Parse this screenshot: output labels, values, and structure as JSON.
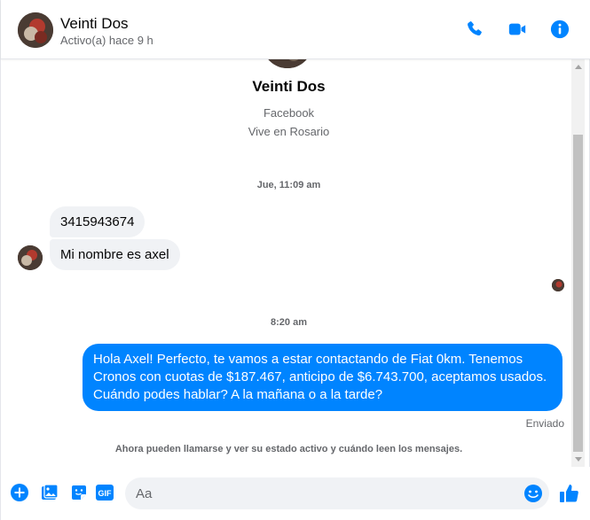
{
  "header": {
    "name": "Veinti Dos",
    "status": "Activo(a) hace 9 h"
  },
  "profile": {
    "name": "Veinti Dos",
    "source": "Facebook",
    "location": "Vive en Rosario"
  },
  "messages": {
    "timestamp_1": "Jue, 11:09 am",
    "incoming": [
      {
        "text": "3415943674"
      },
      {
        "text": "Mi nombre es axel"
      }
    ],
    "timestamp_2": "8:20 am",
    "outgoing": [
      {
        "text": "Hola Axel! Perfecto, te vamos a estar contactando de Fiat 0km. Tenemos Cronos con cuotas de $187.467, anticipo de $6.743.700, aceptamos usados. Cuándo podes hablar? A la mañana o a la tarde?"
      }
    ],
    "sent_status": "Enviado",
    "notice": "Ahora pueden llamarse y ver su estado activo y cuándo leen los mensajes."
  },
  "composer": {
    "placeholder": "Aa",
    "gif_label": "GIF"
  },
  "icons": {
    "call": "phone-icon",
    "video": "video-camera-icon",
    "info": "info-icon",
    "add": "plus-circle-icon",
    "photo": "photo-icon",
    "sticker": "sticker-icon",
    "gif": "gif-icon",
    "emoji": "emoji-icon",
    "like": "thumbs-up-icon"
  },
  "colors": {
    "accent": "#0084ff",
    "incoming_bubble": "#f0f2f5",
    "muted_text": "#65676b"
  }
}
